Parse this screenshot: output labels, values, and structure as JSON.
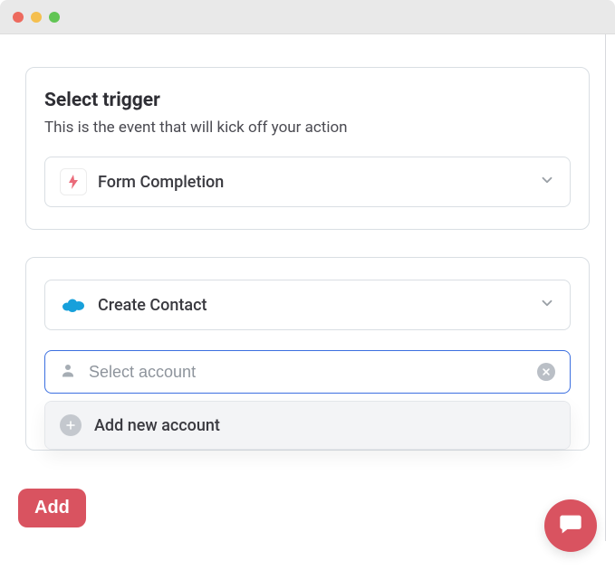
{
  "trigger": {
    "title": "Select trigger",
    "description": "This is the event that will kick off your action",
    "selected_label": "Form Completion"
  },
  "action": {
    "selected_label": "Create Contact",
    "account_placeholder": "Select account",
    "dropdown": {
      "add_new_label": "Add new account"
    }
  },
  "buttons": {
    "add": "Add"
  }
}
